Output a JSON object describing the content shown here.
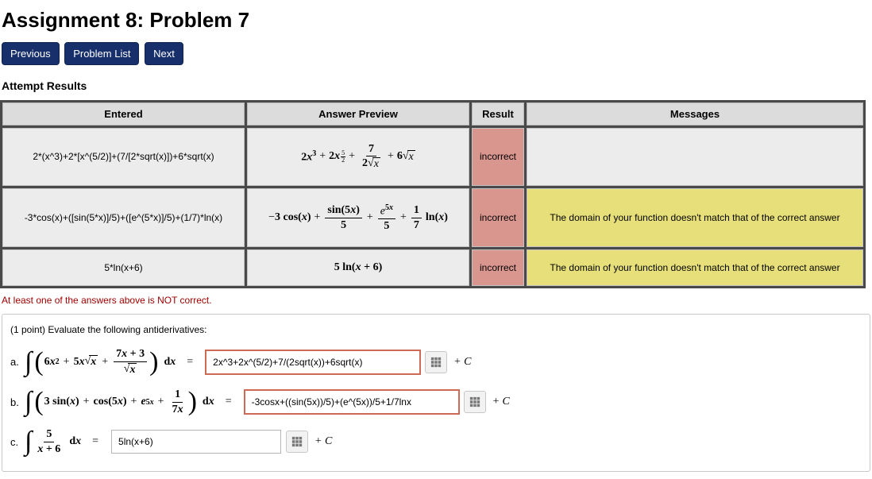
{
  "title": "Assignment 8: Problem 7",
  "nav": {
    "previous": "Previous",
    "problem_list": "Problem List",
    "next": "Next"
  },
  "attempt_heading": "Attempt Results",
  "headers": {
    "entered": "Entered",
    "preview": "Answer Preview",
    "result": "Result",
    "messages": "Messages"
  },
  "rows": [
    {
      "entered": "2*(x^3)+2*[x^(5/2)]+(7/[2*sqrt(x)])+6*sqrt(x)",
      "result": "incorrect",
      "message": ""
    },
    {
      "entered": "-3*cos(x)+([sin(5*x)]/5)+([e^(5*x)]/5)+(1/7)*ln(x)",
      "result": "incorrect",
      "message": "The domain of your function doesn't match that of the correct answer"
    },
    {
      "entered": "5*ln(x+6)",
      "result": "incorrect",
      "message": "The domain of your function doesn't match that of the correct answer"
    }
  ],
  "warning": "At least one of the answers above is NOT correct.",
  "problem_intro": "(1 point) Evaluate the following antiderivatives:",
  "parts": {
    "a": {
      "label": "a.",
      "value": "2x^3+2x^(5/2)+7/(2sqrt(x))+6sqrt(x)"
    },
    "b": {
      "label": "b.",
      "value": "-3cosx+((sin(5x))/5)+(e^(5x))/5+1/7lnx"
    },
    "c": {
      "label": "c.",
      "value": "5ln(x+6)"
    }
  },
  "plus_c": "+ C",
  "dx_eq": "dx   ="
}
